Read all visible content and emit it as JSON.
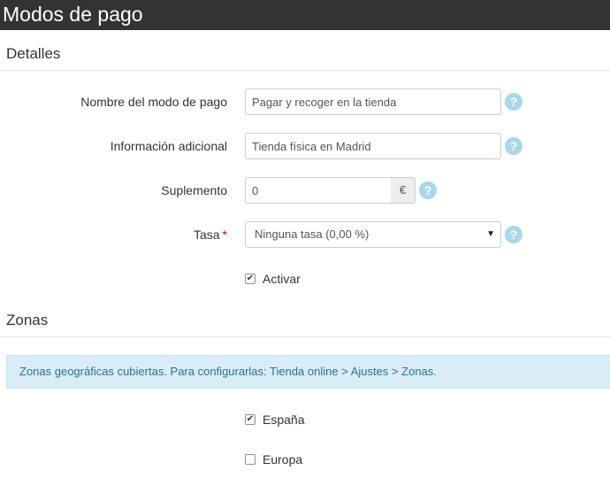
{
  "page": {
    "title": "Modos de pago"
  },
  "details": {
    "heading": "Detalles",
    "name_label": "Nombre del modo de pago",
    "name_value": "Pagar y recoger en la tienda",
    "info_label": "Información adicional",
    "info_value": "Tienda física en Madrid",
    "surcharge_label": "Suplemento",
    "surcharge_value": "0",
    "surcharge_unit": "€",
    "tax_label": "Tasa",
    "tax_required_mark": "*",
    "tax_selected": "Ninguna tasa (0,00 %)",
    "activate_label": "Activar",
    "activate_checked": true,
    "help_glyph": "?",
    "caret_glyph": "▼"
  },
  "zones": {
    "heading": "Zonas",
    "info_text": "Zonas geográficas cubiertas. Para configurarlas: Tienda online > Ajustes > Zonas.",
    "items": [
      {
        "label": "España",
        "checked": true
      },
      {
        "label": "Europa",
        "checked": false
      }
    ],
    "check_glyph": "✔"
  },
  "colors": {
    "header_bg": "#333333",
    "help_icon": "#a8d8ea",
    "info_bg": "#d9edf7",
    "info_text": "#31708f",
    "required": "#cc0000"
  },
  "icons": [
    "help-icon",
    "select-caret-icon",
    "checkbox-checked-icon"
  ]
}
